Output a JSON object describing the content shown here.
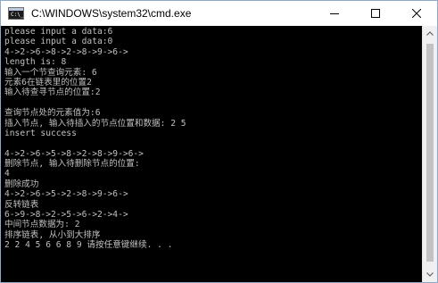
{
  "window": {
    "title": "C:\\WINDOWS\\system32\\cmd.exe",
    "icon_prompt": "C:\\_"
  },
  "controls": [
    "minimize-icon",
    "maximize-icon",
    "close-icon"
  ],
  "console": {
    "lines": [
      "please input a data:6",
      "please input a data:0",
      "4->2->6->8->2->8->9->6->",
      "length is: 8",
      "输入一个节查询元素: 6",
      "元素6在链表里的位置2",
      "输入待查寻节点的位置:2",
      "",
      "查询节点处的元素值为:6",
      "插入节点, 输入待插入的节点位置和数据: 2 5",
      "insert success",
      "",
      "4->2->6->5->8->2->8->9->6->",
      "删除节点, 输入待删除节点的位置:",
      "4",
      "删除成功",
      "4->2->6->5->2->8->9->6->",
      "反转链表",
      "6->9->8->2->5->6->2->4->",
      "中间节点数据为: 2",
      "排序链表, 从小到大排序",
      "2 2 4 5 6 6 8 9 请按任意键继续. . ."
    ],
    "text_color": "#c0c0c0",
    "background": "#000000"
  }
}
